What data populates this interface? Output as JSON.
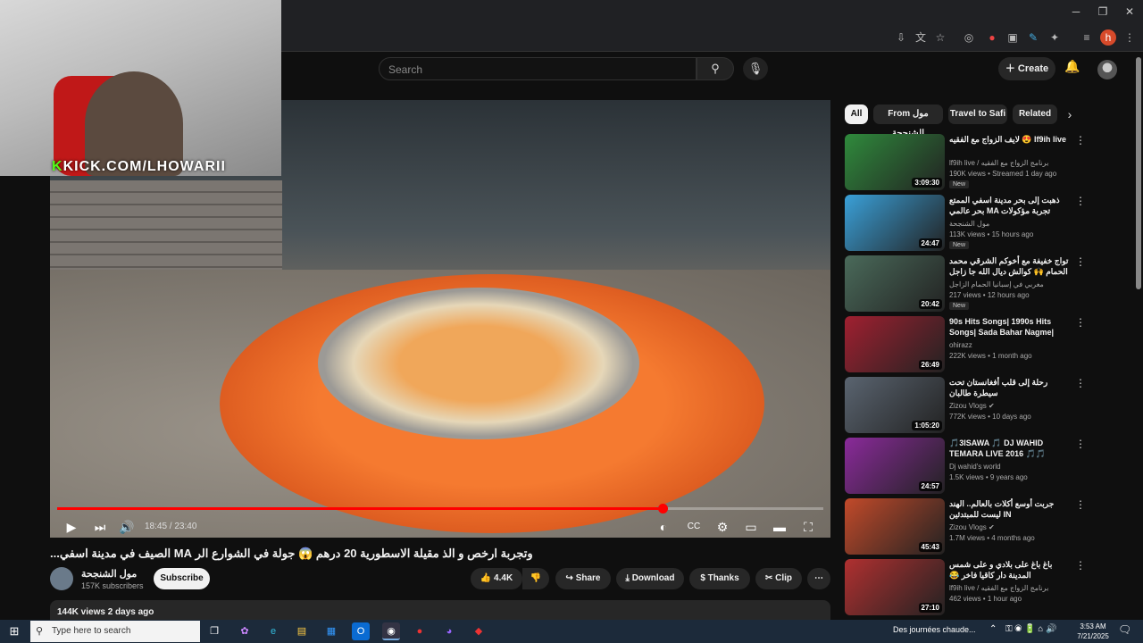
{
  "search": {
    "placeholder": "Search"
  },
  "header": {
    "create_label": "Create"
  },
  "overlay": {
    "kick_prefix": "K",
    "kick_rest": "KICK.COM/LHOWARII"
  },
  "player": {
    "time": "18:45 / 23:40",
    "progress": 0.79
  },
  "video": {
    "title": "وتجربة ارخص و الذ مقيلة الاسطورية 20 درهم 😱 جولة في الشوارع الر MA الصيف في مدينة اسفي...",
    "channel": "مول الشنجحة",
    "subscribers": "157K subscribers",
    "subscribe_label": "Subscribe",
    "likes": "4.4K",
    "share_label": "Share",
    "download_label": "Download",
    "thanks_label": "Thanks",
    "clip_label": "Clip",
    "views_line": "144K views  2 days ago"
  },
  "chips": [
    "All",
    "From مول الشنجحة",
    "Travel to Safi",
    "Related"
  ],
  "recommendations": [
    {
      "title": "لايف الزواج مع الفقيه 😍 lf9ih live",
      "channel": "lf9ih live / برنامج الزواج مع الفقيه",
      "meta": "190K views • Streamed 1 day ago",
      "duration": "3:09:30",
      "new": "New",
      "color": "#2f8a3c"
    },
    {
      "title": "ذهبت إلى بحر مدينة اسفي الممتع بحر عالمي MA تجربة مؤكولات المرسة الد الاطاق مع",
      "channel": "مول الشنجحة",
      "meta": "113K views • 15 hours ago",
      "duration": "24:47",
      "new": "New",
      "color": "#3aa0d8"
    },
    {
      "title": "تواج خفيفة مع أخوكم الشرقي محمد الحمام 🙌 كوالش ديال الله جا زاجل في إسبانيا ...",
      "channel": "مغربي في إسبانيا الحمام الزاجل",
      "meta": "217 views • 12 hours ago",
      "duration": "20:42",
      "new": "New",
      "color": "#4a6a5a"
    },
    {
      "title": "90s Hits Songs| 1990s Hits Songs| Sada Bahar Nagme| Sr...",
      "channel": "ohirazz",
      "meta": "222K views • 1 month ago",
      "duration": "26:49",
      "new": "",
      "color": "#a02030"
    },
    {
      "title": "رحلة إلى قلب أفغانستان تحت سيطرة طالبان",
      "channel": "Zizou Vlogs ✔",
      "meta": "772K views • 10 days ago",
      "duration": "1:05:20",
      "new": "",
      "color": "#5a6470"
    },
    {
      "title": "🎵3ISAWA 🎵 DJ WAHID TEMARA LIVE 2016 🎵🎵",
      "channel": "Dj wahid's world",
      "meta": "1.5K views • 9 years ago",
      "duration": "24:57",
      "new": "",
      "color": "#8a2a9a"
    },
    {
      "title": "جربت أوسع أكلات بالعالم.. الهند ليست للمبتدئين IN",
      "channel": "Zizou Vlogs ✔",
      "meta": "1.7M views • 4 months ago",
      "duration": "45:43",
      "new": "",
      "color": "#c24a2a"
    },
    {
      "title": "باغ باغ على بلادي و على شمس المدينة دار كاقيا فاخر 😂 ماشيمكنش",
      "channel": "lf9ih live / برنامج الزواج مع الفقيه",
      "meta": "462 views • 1 hour ago",
      "duration": "27:10",
      "new": "",
      "color": "#b03030"
    }
  ],
  "taskbar": {
    "search_placeholder": "Type here to search",
    "weather": "Des journées chaude...",
    "time": "3:53 AM",
    "date": "7/21/2025"
  }
}
